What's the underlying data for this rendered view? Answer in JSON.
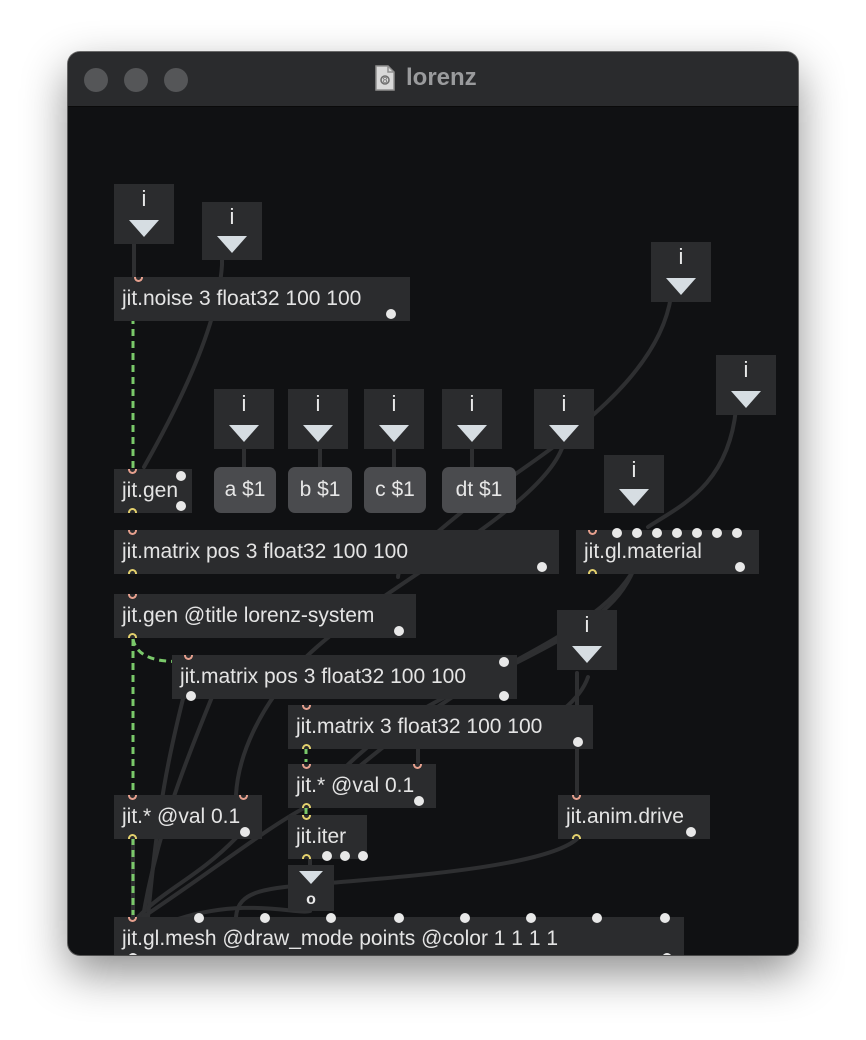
{
  "window": {
    "title": "lorenz",
    "title_icon": "patcher-document-icon"
  },
  "integer_boxes": {
    "label": "i"
  },
  "objects": {
    "noise": "jit.noise 3 float32 100 100",
    "gen1": "jit.gen",
    "matrix_pos": "jit.matrix pos 3 float32 100 100",
    "gl_material": "jit.gl.material",
    "gen_lorenz": "jit.gen @title lorenz-system",
    "matrix_pos2": "jit.matrix pos 3 float32 100 100",
    "matrix3": "jit.matrix 3 float32 100 100",
    "mul2": "jit.* @val 0.1",
    "mul1": "jit.* @val 0.1",
    "iter": "jit.iter",
    "anim_drive": "jit.anim.drive",
    "mesh": "jit.gl.mesh @draw_mode points @color 1 1 1 1"
  },
  "messages": {
    "a": "a $1",
    "b": "b $1",
    "c": "c $1",
    "dt": "dt $1"
  },
  "bang": {
    "label": "o"
  },
  "colors": {
    "window_bg": "#101113",
    "object_bg": "#2b2c2e",
    "message_bg": "#4a4b4e",
    "matrix_cord": "#7ac96a",
    "cord": "#2e2f31"
  }
}
